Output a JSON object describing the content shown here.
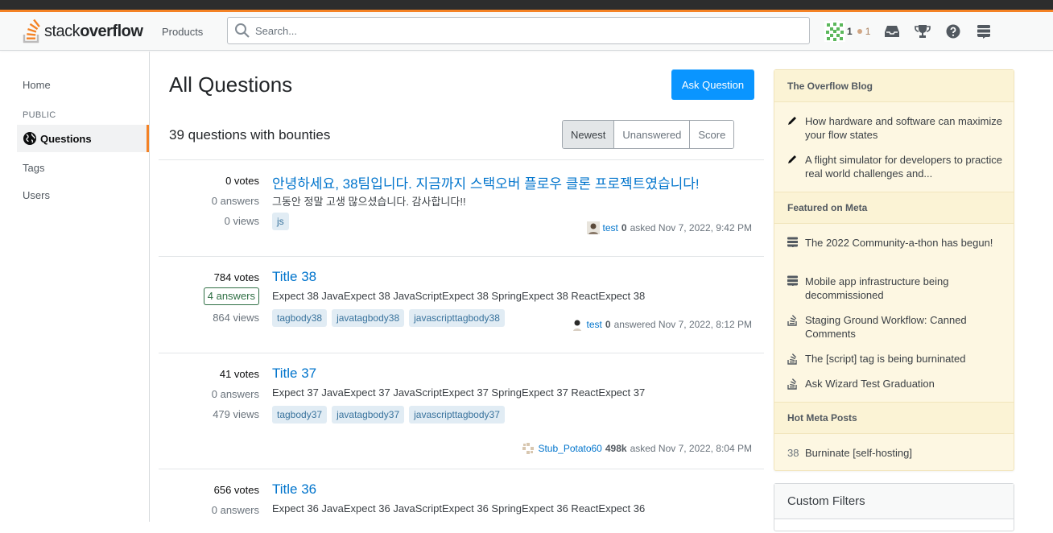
{
  "header": {
    "logo_text_light": "stack",
    "logo_text_bold": "overflow",
    "products_label": "Products",
    "search_placeholder": "Search...",
    "reputation": "1",
    "bronze_badges": "1"
  },
  "sidebar": {
    "home": "Home",
    "public": "PUBLIC",
    "questions": "Questions",
    "tags": "Tags",
    "users": "Users"
  },
  "main": {
    "title": "All Questions",
    "ask_button": "Ask Question",
    "count": "39 questions with bounties",
    "filters": [
      "Newest",
      "Unanswered",
      "Score"
    ]
  },
  "questions": [
    {
      "votes": "0 votes",
      "answers": "0 answers",
      "views": "0 views",
      "title": "안녕하세요, 38팀입니다. 지금까지 스택오버 플로우 클론 프로젝트였습니다!",
      "excerpt": "그동안 정말 고생 많으셨습니다. 감사합니다!!",
      "tags": [
        "js"
      ],
      "user": "test",
      "user_rep": "0",
      "action": "asked Nov 7, 2022, 9:42 PM"
    },
    {
      "votes": "784 votes",
      "answers": "4 answers",
      "views": "864 views",
      "title": "Title 38",
      "excerpt": "Expect 38 JavaExpect 38 JavaScriptExpect 38 SpringExpect 38 ReactExpect 38",
      "tags": [
        "tagbody38",
        "javatagbody38",
        "javascripttagbody38"
      ],
      "user": "test",
      "user_rep": "0",
      "action": "answered Nov 7, 2022, 8:12 PM"
    },
    {
      "votes": "41 votes",
      "answers": "0 answers",
      "views": "479 views",
      "title": "Title 37",
      "excerpt": "Expect 37 JavaExpect 37 JavaScriptExpect 37 SpringExpect 37 ReactExpect 37",
      "tags": [
        "tagbody37",
        "javatagbody37",
        "javascripttagbody37"
      ],
      "user": "Stub_Potato60",
      "user_rep": "498k",
      "action": "asked Nov 7, 2022, 8:04 PM"
    },
    {
      "votes": "656 votes",
      "answers": "0 answers",
      "title": "Title 36",
      "excerpt": "Expect 36 JavaExpect 36 JavaScriptExpect 36 SpringExpect 36 ReactExpect 36"
    }
  ],
  "right": {
    "blog_header": "The Overflow Blog",
    "blog_items": [
      "How hardware and software can maximize your flow states",
      "A flight simulator for developers to practice real world challenges and..."
    ],
    "meta_header": "Featured on Meta",
    "meta_items": [
      "The 2022 Community-a-thon has begun!",
      "Mobile app infrastructure being decommissioned",
      "Staging Ground Workflow: Canned Comments",
      "The [script] tag is being burninated",
      "Ask Wizard Test Graduation"
    ],
    "hot_header": "Hot Meta Posts",
    "hot_items": [
      {
        "count": "38",
        "text": "Burninate [self-hosting]"
      }
    ],
    "custom_filters": "Custom Filters"
  },
  "colors": {
    "accent": "#f48225",
    "link": "#0074cc",
    "primary_button": "#0a95ff",
    "tag_bg": "#e1ecf4",
    "tag_text": "#39739d",
    "blog_bg": "#fdf7e2",
    "answered_green": "#2f6f44"
  }
}
